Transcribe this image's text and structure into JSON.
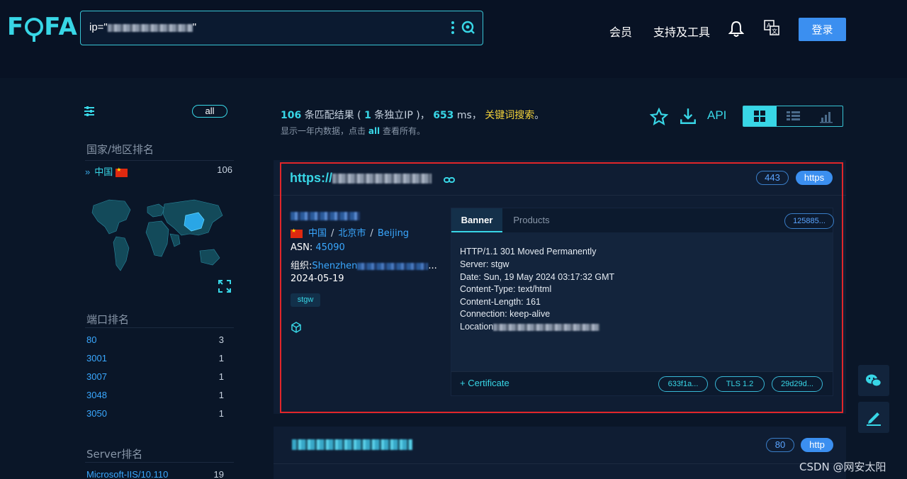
{
  "header": {
    "logo": "FOFA",
    "search_value": "ip=\"",
    "search_close": "\"",
    "nav_member": "会员",
    "nav_tools": "支持及工具",
    "login": "登录"
  },
  "sidebar": {
    "all_label": "all",
    "country_title": "国家/地区排名",
    "country": {
      "name": "中国",
      "count": "106"
    },
    "port_title": "端口排名",
    "ports": [
      {
        "port": "80",
        "count": "3"
      },
      {
        "port": "3001",
        "count": "1"
      },
      {
        "port": "3007",
        "count": "1"
      },
      {
        "port": "3048",
        "count": "1"
      },
      {
        "port": "3050",
        "count": "1"
      }
    ],
    "server_title": "Server排名",
    "servers": [
      {
        "name": "Microsoft-IIS/10.110",
        "count": "19"
      }
    ]
  },
  "stats": {
    "total": "106",
    "total_label": "条匹配结果 (",
    "unique": "1",
    "unique_label": "条独立IP )，",
    "ms": "653",
    "ms_label": "ms，",
    "keyword": "关键词搜索",
    "end": "。",
    "sub_prefix": "显示一年内数据，点击",
    "sub_all": "all",
    "sub_suffix": "查看所有。"
  },
  "toolbar": {
    "api": "API"
  },
  "result": {
    "url_prefix": "https://",
    "port": "443",
    "protocol": "https",
    "geo_country": "中国",
    "geo_city": "北京市",
    "geo_region": "Beijing",
    "asn_label": "ASN:",
    "asn": "45090",
    "org_label": "组织:",
    "org": "Shenzhen",
    "org_ellipsis": "...",
    "date": "2024-05-19",
    "tag": "stgw",
    "tab_banner": "Banner",
    "tab_products": "Products",
    "hash": "125885...",
    "banner": [
      "HTTP/1.1 301 Moved Permanently",
      "Server: stgw",
      "Date: Sun, 19 May 2024 03:17:32 GMT",
      "Content-Type: text/html",
      "Content-Length: 161",
      "Connection: keep-alive",
      "Location"
    ],
    "cert_label": "+ Certificate",
    "cert_pills": [
      "633f1a...",
      "TLS 1.2",
      "29d29d..."
    ]
  },
  "result2": {
    "port": "80",
    "protocol": "http"
  },
  "watermark": "CSDN @网安太阳",
  "colors": {
    "accent": "#38d6e6",
    "link": "#3aa8ff",
    "keyword": "#f3d23a",
    "frame": "#e0262a",
    "button": "#3b8ff0"
  }
}
